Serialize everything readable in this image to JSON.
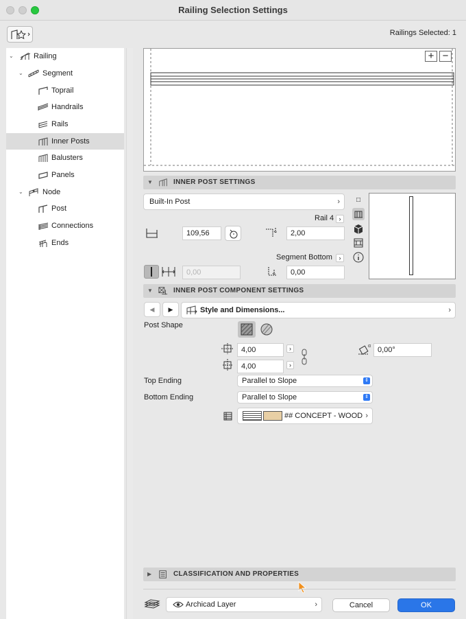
{
  "window": {
    "title": "Railing Selection Settings"
  },
  "header": {
    "selected_count": "Railings Selected: 1"
  },
  "sidebar": {
    "items": [
      {
        "label": "Railing",
        "icon": "railing-icon",
        "expanded": true
      },
      {
        "label": "Segment",
        "icon": "segment-icon",
        "expanded": true
      },
      {
        "label": "Toprail",
        "icon": "toprail-icon"
      },
      {
        "label": "Handrails",
        "icon": "handrails-icon"
      },
      {
        "label": "Rails",
        "icon": "rails-icon"
      },
      {
        "label": "Inner Posts",
        "icon": "inner-posts-icon",
        "selected": true
      },
      {
        "label": "Balusters",
        "icon": "balusters-icon"
      },
      {
        "label": "Panels",
        "icon": "panels-icon"
      },
      {
        "label": "Node",
        "icon": "node-icon",
        "expanded": true
      },
      {
        "label": "Post",
        "icon": "post-icon"
      },
      {
        "label": "Connections",
        "icon": "connections-icon"
      },
      {
        "label": "Ends",
        "icon": "ends-icon"
      }
    ]
  },
  "inner_post_settings": {
    "title": "INNER POST SETTINGS",
    "post_type": "Built-In Post",
    "top_reference": "Rail 4",
    "height": "109,56",
    "top_offset": "2,00",
    "bottom_reference": "Segment Bottom",
    "spacing": "0,00",
    "bottom_offset": "0,00"
  },
  "component_settings": {
    "title": "INNER POST COMPONENT SETTINGS",
    "panel_name": "Style and Dimensions...",
    "post_shape_label": "Post Shape",
    "width": "4,00",
    "depth": "4,00",
    "rotation": "0,00°",
    "top_ending_label": "Top Ending",
    "top_ending": "Parallel to Slope",
    "bottom_ending_label": "Bottom Ending",
    "bottom_ending": "Parallel to Slope",
    "material": "## CONCEPT - WOOD",
    "material_color": "#e8cfa5"
  },
  "classification": {
    "title": "CLASSIFICATION AND PROPERTIES"
  },
  "footer": {
    "layer": "Archicad Layer",
    "cancel": "Cancel",
    "ok": "OK"
  },
  "colors": {
    "accent": "#2a76e8",
    "cursor": "#f0901e"
  }
}
